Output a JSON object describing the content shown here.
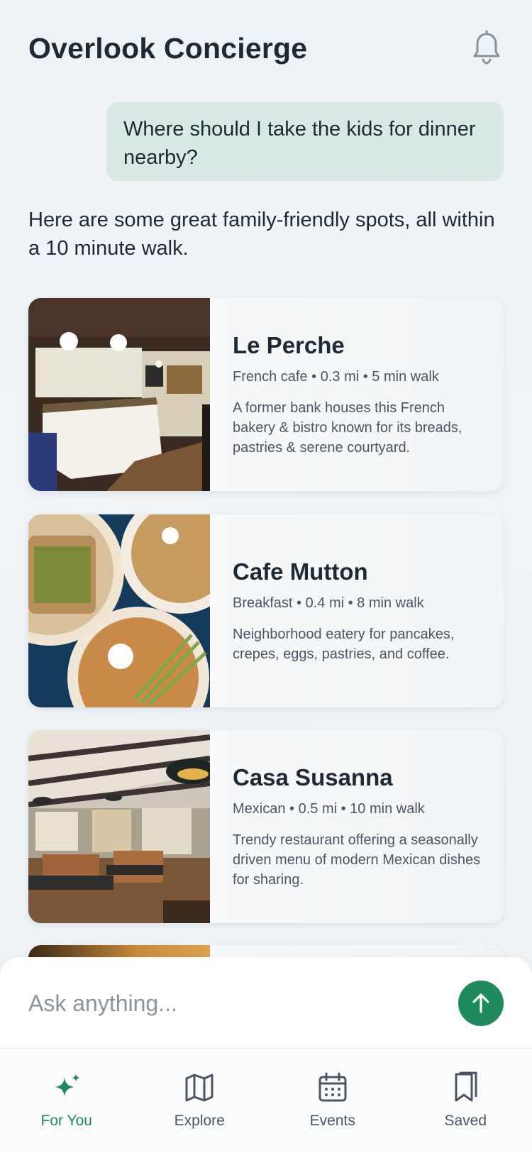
{
  "app": {
    "title": "Overlook Concierge"
  },
  "chat": {
    "user_message": "Where should I take the kids for dinner nearby?",
    "assistant_message": "Here are some great family-friendly spots, all within a 10 minute walk."
  },
  "results": [
    {
      "name": "Le Perche",
      "meta": "French cafe • 0.3 mi • 5 min walk",
      "description": "A former bank houses this French bakery & bistro known for its breads, pastries & serene courtyard."
    },
    {
      "name": "Cafe Mutton",
      "meta": "Breakfast • 0.4 mi • 8 min walk",
      "description": "Neighborhood eatery for pancakes, crepes, eggs, pastries, and coffee."
    },
    {
      "name": "Casa Susanna",
      "meta": "Mexican • 0.5 mi • 10 min walk",
      "description": "Trendy restaurant offering a seasonally driven menu of modern Mexican dishes for sharing."
    }
  ],
  "composer": {
    "placeholder": "Ask anything..."
  },
  "tabs": [
    {
      "label": "For You",
      "icon": "sparkle-icon",
      "active": true
    },
    {
      "label": "Explore",
      "icon": "map-icon",
      "active": false
    },
    {
      "label": "Events",
      "icon": "calendar-icon",
      "active": false
    },
    {
      "label": "Saved",
      "icon": "bookmarks-icon",
      "active": false
    }
  ],
  "colors": {
    "accent": "#1f8a5c",
    "user_bubble": "#dbe9e6",
    "text": "#1f2933"
  }
}
